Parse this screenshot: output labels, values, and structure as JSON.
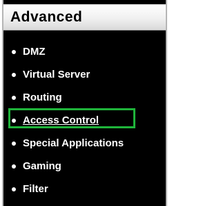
{
  "header": {
    "title": "Advanced"
  },
  "menu": {
    "items": [
      {
        "label": "DMZ",
        "active": false
      },
      {
        "label": "Virtual Server",
        "active": false
      },
      {
        "label": "Routing",
        "active": false
      },
      {
        "label": "Access Control",
        "active": true
      },
      {
        "label": "Special Applications",
        "active": false
      },
      {
        "label": "Gaming",
        "active": false
      },
      {
        "label": "Filter",
        "active": false
      }
    ]
  },
  "colors": {
    "background": "#000000",
    "text": "#ffffff",
    "highlight": "#1fb43a"
  }
}
